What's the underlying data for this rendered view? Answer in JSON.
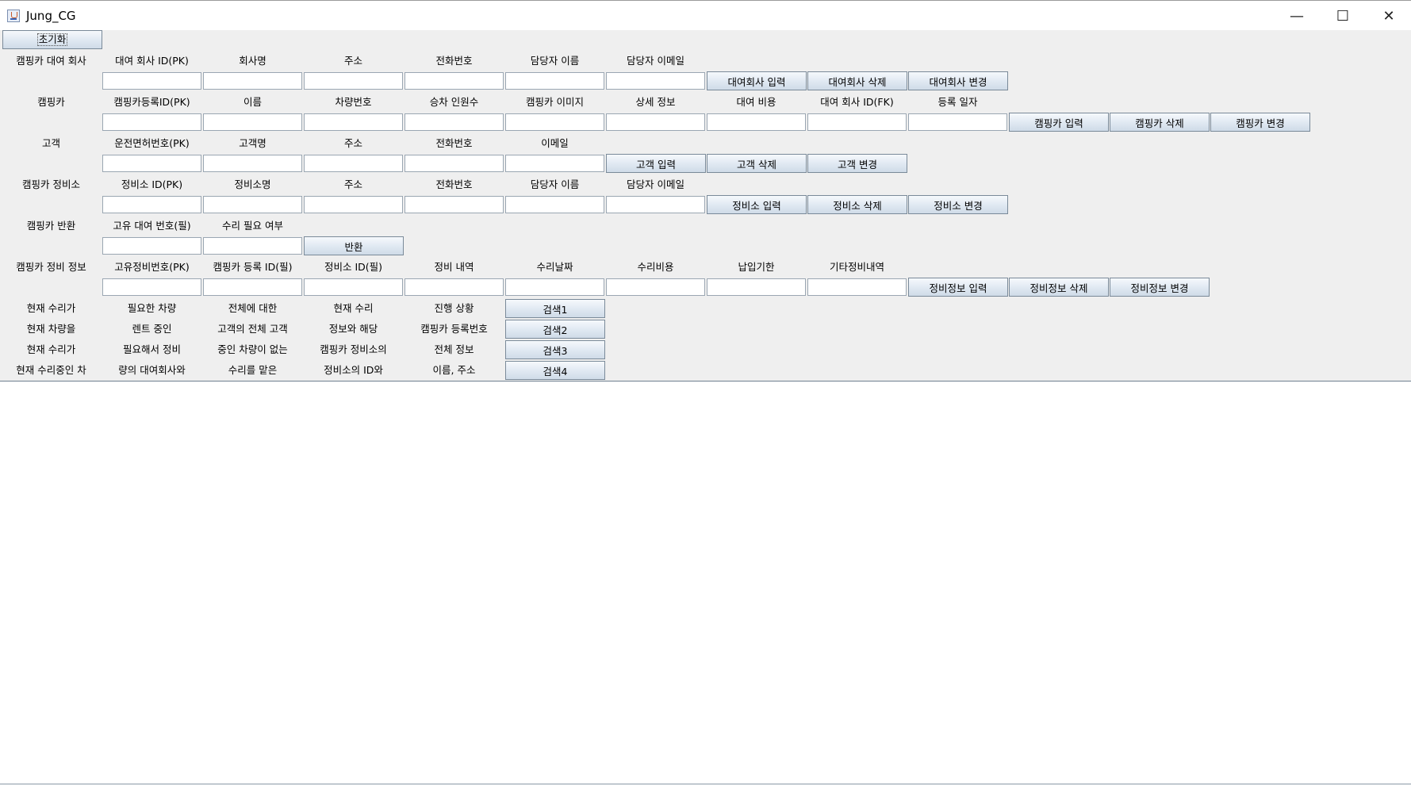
{
  "window": {
    "title": "Jung_CG",
    "minimize_glyph": "—",
    "maximize_glyph": "☐",
    "close_glyph": "✕"
  },
  "reset_button": "초기화",
  "sections": {
    "rental_company": {
      "label": "캠핑카 대여 회사",
      "columns": [
        "대여 회사 ID(PK)",
        "회사명",
        "주소",
        "전화번호",
        "담당자 이름",
        "담당자 이메일"
      ],
      "buttons": [
        "대여회사 입력",
        "대여회사 삭제",
        "대여회사 변경"
      ]
    },
    "camping_car": {
      "label": "캠핑카",
      "columns": [
        "캠핑카등록ID(PK)",
        "이름",
        "차량번호",
        "승차 인원수",
        "캠핑카 이미지",
        "상세 정보",
        "대여 비용",
        "대여 회사 ID(FK)",
        "등록 일자"
      ],
      "buttons": [
        "캠핑카 입력",
        "캠핑카 삭제",
        "캠핑카 변경"
      ]
    },
    "customer": {
      "label": "고객",
      "columns": [
        "운전면허번호(PK)",
        "고객명",
        "주소",
        "전화번호",
        "이메일"
      ],
      "buttons": [
        "고객 입력",
        "고객 삭제",
        "고객 변경"
      ]
    },
    "repair_shop": {
      "label": "캠핑카 정비소",
      "columns": [
        "정비소 ID(PK)",
        "정비소명",
        "주소",
        "전화번호",
        "담당자 이름",
        "담당자 이메일"
      ],
      "buttons": [
        "정비소 입력",
        "정비소 삭제",
        "정비소 변경"
      ]
    },
    "car_return": {
      "label": "캠핑카 반환",
      "columns": [
        "고유 대여 번호(필)",
        "수리 필요 여부"
      ],
      "buttons": [
        "반환"
      ]
    },
    "maintenance_info": {
      "label": "캠핑카 정비 정보",
      "columns": [
        "고유정비번호(PK)",
        "캠핑카 등록 ID(필)",
        "정비소 ID(필)",
        "정비 내역",
        "수리날짜",
        "수리비용",
        "납입기한",
        "기타정비내역"
      ],
      "buttons": [
        "정비정보 입력",
        "정비정보 삭제",
        "정비정보 변경"
      ]
    }
  },
  "searches": [
    {
      "texts": [
        "현재 수리가",
        "필요한 차량",
        "전체에 대한",
        "현재 수리",
        "진행 상황"
      ],
      "button": "검색1"
    },
    {
      "texts": [
        "현재 차량을",
        "렌트 중인",
        "고객의 전체 고객",
        "정보와 해당",
        "캠핑카 등록번호"
      ],
      "button": "검색2"
    },
    {
      "texts": [
        "현재 수리가",
        "필요해서 정비",
        "중인 차량이 없는",
        "캠핑카 정비소의",
        "전체 정보"
      ],
      "button": "검색3"
    },
    {
      "texts": [
        "현재 수리중인 차",
        "량의 대여회사와",
        "수리를 맡은",
        "정비소의 ID와",
        "이름, 주소"
      ],
      "button": "검색4"
    }
  ]
}
